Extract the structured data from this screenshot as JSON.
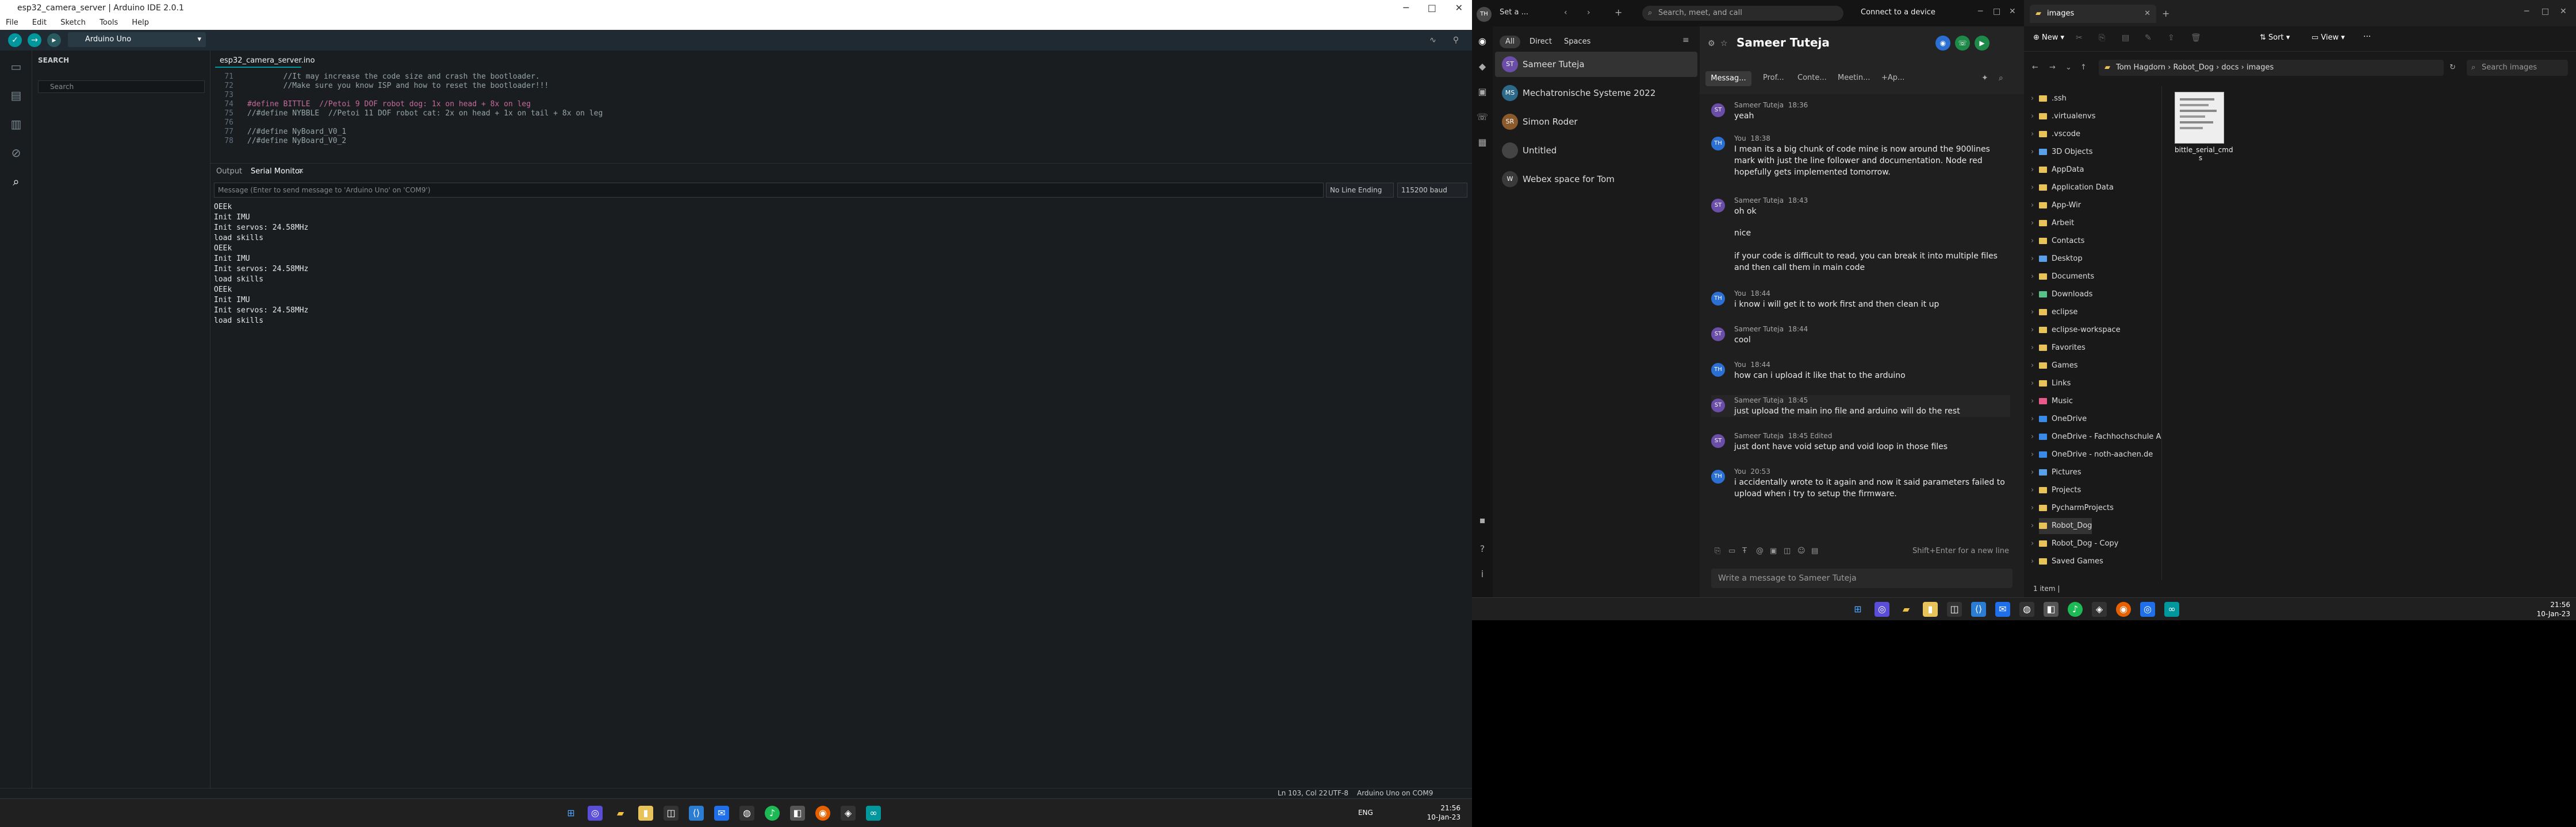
{
  "arduino": {
    "window_title": "esp32_camera_server | Arduino IDE 2.0.1",
    "menu": [
      "File",
      "Edit",
      "Sketch",
      "Tools",
      "Help"
    ],
    "board": "Arduino Uno",
    "sidebar_title": "SEARCH",
    "search_placeholder": "Search",
    "file_tab": "esp32_camera_server.ino",
    "code": [
      {
        "ln": "71",
        "text": "        //It may increase the code size and crash the bootloader."
      },
      {
        "ln": "72",
        "text": "        //Make sure you know ISP and how to reset the bootloader!!!"
      },
      {
        "ln": "73",
        "text": ""
      },
      {
        "ln": "74",
        "text": "#define BITTLE  //Petoi 9 DOF robot dog: 1x on head + 8x on leg"
      },
      {
        "ln": "75",
        "text": "//#define NYBBLE  //Petoi 11 DOF robot cat: 2x on head + 1x on tail + 8x on leg"
      },
      {
        "ln": "76",
        "text": ""
      },
      {
        "ln": "77",
        "text": "//#define NyBoard_V0_1"
      },
      {
        "ln": "78",
        "text": "//#define NyBoard_V0_2"
      }
    ],
    "panel_tab_output": "Output",
    "panel_tab_serial": "Serial Monitor",
    "serial_input_placeholder": "Message (Enter to send message to 'Arduino Uno' on 'COM9')",
    "line_ending": "No Line Ending",
    "baud": "115200 baud",
    "serial_lines": [
      "OEEk",
      "Init IMU",
      "Init servos: 24.58MHz",
      "load skills",
      "OEEk",
      "Init IMU",
      "Init servos: 24.58MHz",
      "load skills",
      "OEEk",
      "Init IMU",
      "Init servos: 24.58MHz",
      "load skills"
    ],
    "status_pos": "Ln 103, Col 22",
    "status_enc": "UTF-8",
    "status_board": "Arduino Uno on COM9",
    "tray_lang": "ENG",
    "tray_time": "21:56",
    "tray_date": "10-Jan-23"
  },
  "teams": {
    "search_placeholder": "Search, meet, and call",
    "connect_device": "Connect to a device",
    "filters": [
      "All",
      "Direct",
      "Spaces"
    ],
    "chats": [
      {
        "initials": "ST",
        "name": "Sameer Tuteja",
        "color": "#6b4ea8"
      },
      {
        "initials": "MS",
        "name": "Mechatronische Systeme 2022",
        "color": "#2d6a8a"
      },
      {
        "initials": "SR",
        "name": "Simon Roder",
        "color": "#8a5a2d"
      },
      {
        "initials": "",
        "name": "Untitled",
        "color": "#444444"
      },
      {
        "initials": "W",
        "name": "Webex space for Tom",
        "color": "#3a3a3a"
      }
    ],
    "chat_title": "Sameer Tuteja",
    "chat_tabs": [
      "Messag...",
      "Prof...",
      "Conte...",
      "Meetin...",
      "+Ap..."
    ],
    "messages": [
      {
        "who": "Sameer Tuteja",
        "time": "18:36",
        "text": "yeah"
      },
      {
        "who": "You",
        "time": "18:38",
        "text": "I mean its a big chunk of code mine is now around the 900lines mark with just the line follower and documentation. Node red hopefully gets implemented tomorrow."
      },
      {
        "who": "Sameer Tuteja",
        "time": "18:43",
        "text": "oh ok"
      },
      {
        "who": "",
        "time": "",
        "text": "nice"
      },
      {
        "who": "",
        "time": "",
        "text": "if your code is difficult to read, you can break it into multiple files and then call them in main code"
      },
      {
        "who": "You",
        "time": "18:44",
        "text": "i know i will get it to work first and then clean it up"
      },
      {
        "who": "Sameer Tuteja",
        "time": "18:44",
        "text": "cool"
      },
      {
        "who": "You",
        "time": "18:44",
        "text": "how can i upload it like that to the arduino"
      },
      {
        "who": "Sameer Tuteja",
        "time": "18:45",
        "text": "just upload the main ino file and arduino will do the rest"
      },
      {
        "who": "Sameer Tuteja",
        "time": "18:45 Edited",
        "text": "just dont have void setup and void loop in those files"
      },
      {
        "who": "You",
        "time": "20:53",
        "text": "i accidentally wrote to it again and now it said parameters failed to upload when i try to setup the firmware."
      }
    ],
    "compose_hint": "Shift+Enter for a new line",
    "compose_placeholder": "Write a message to Sameer Tuteja"
  },
  "explorer": {
    "tab_title": "images",
    "new_label": "New",
    "sort_label": "Sort",
    "view_label": "View",
    "breadcrumb": [
      "Tom Hagdorn",
      "Robot_Dog",
      "docs",
      "images"
    ],
    "search_placeholder": "Search images",
    "tree": [
      {
        "name": ".ssh",
        "color": "#e8c35a"
      },
      {
        "name": ".virtualenvs",
        "color": "#e8c35a"
      },
      {
        "name": ".vscode",
        "color": "#e8c35a"
      },
      {
        "name": "3D Objects",
        "color": "#5aa0e8"
      },
      {
        "name": "AppData",
        "color": "#e8c35a"
      },
      {
        "name": "Application Data",
        "color": "#e8c35a"
      },
      {
        "name": "App-Wir",
        "color": "#e8c35a"
      },
      {
        "name": "Arbeit",
        "color": "#e8c35a"
      },
      {
        "name": "Contacts",
        "color": "#e8c35a"
      },
      {
        "name": "Desktop",
        "color": "#5aa0e8"
      },
      {
        "name": "Documents",
        "color": "#e8c35a"
      },
      {
        "name": "Downloads",
        "color": "#5ac08a"
      },
      {
        "name": "eclipse",
        "color": "#e8c35a"
      },
      {
        "name": "eclipse-workspace",
        "color": "#e8c35a"
      },
      {
        "name": "Favorites",
        "color": "#e8c35a"
      },
      {
        "name": "Games",
        "color": "#e8c35a"
      },
      {
        "name": "Links",
        "color": "#e8c35a"
      },
      {
        "name": "Music",
        "color": "#e85a8a"
      },
      {
        "name": "OneDrive",
        "color": "#3a8ae8"
      },
      {
        "name": "OneDrive - Fachhochschule A",
        "color": "#3a8ae8"
      },
      {
        "name": "OneDrive - noth-aachen.de",
        "color": "#3a8ae8"
      },
      {
        "name": "Pictures",
        "color": "#5aa0e8"
      },
      {
        "name": "Projects",
        "color": "#e8c35a"
      },
      {
        "name": "PycharmProjects",
        "color": "#e8c35a"
      },
      {
        "name": "Robot_Dog",
        "color": "#e8c35a"
      },
      {
        "name": "Robot_Dog - Copy",
        "color": "#e8c35a"
      },
      {
        "name": "Saved Games",
        "color": "#e8c35a"
      }
    ],
    "file_name": "bittle_serial_cmd s",
    "status": "1 item |",
    "tray_time": "21:56",
    "tray_date": "10-Jan-23"
  }
}
